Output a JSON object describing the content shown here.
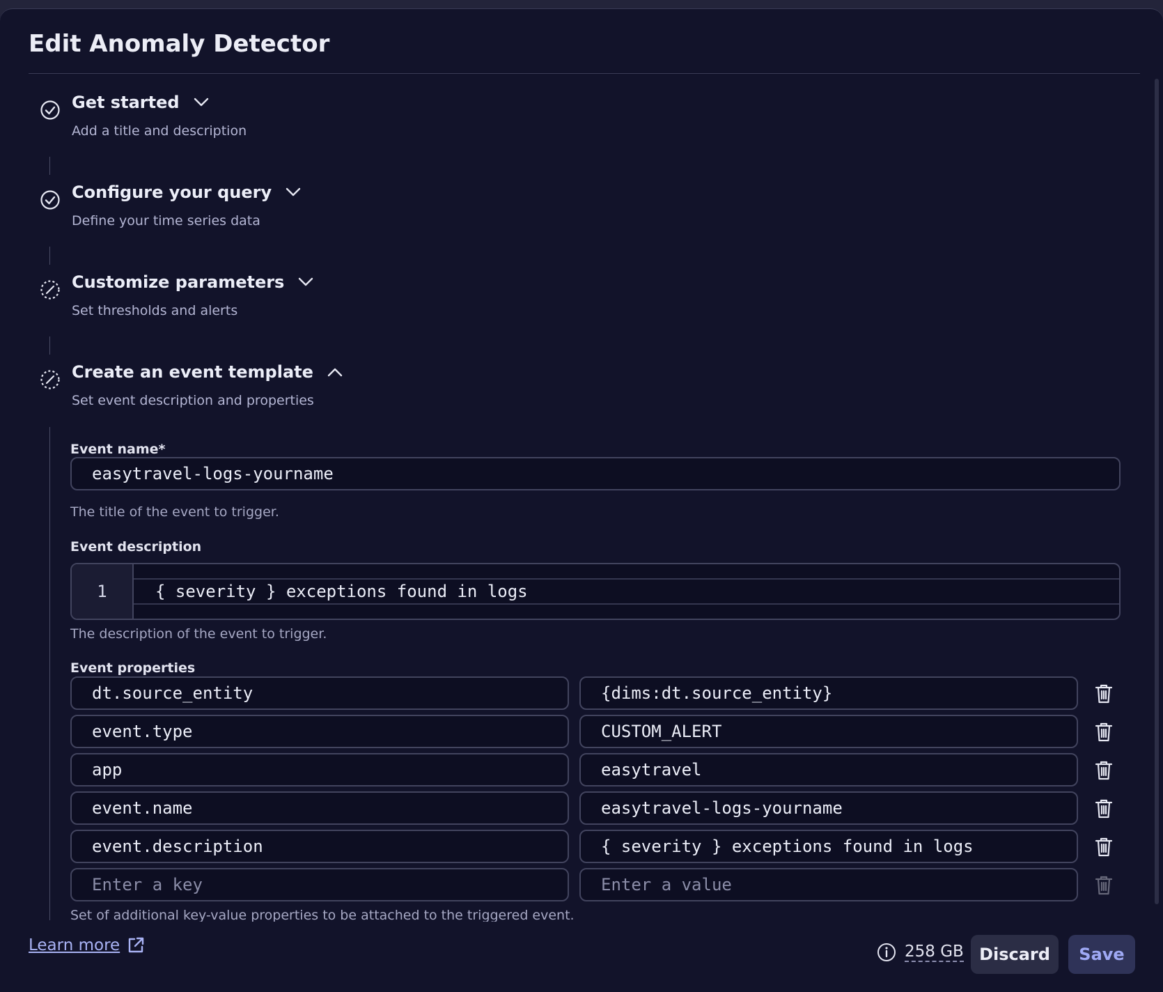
{
  "dialog": {
    "title": "Edit Anomaly Detector"
  },
  "steps": [
    {
      "title": "Get started",
      "subtitle": "Add a title and description",
      "status": "complete",
      "expanded": false
    },
    {
      "title": "Configure your query",
      "subtitle": "Define your time series data",
      "status": "complete",
      "expanded": false
    },
    {
      "title": "Customize parameters",
      "subtitle": "Set thresholds and alerts",
      "status": "pending",
      "expanded": false
    },
    {
      "title": "Create an event template",
      "subtitle": "Set event description and properties",
      "status": "pending",
      "expanded": true
    }
  ],
  "event_template": {
    "name_label": "Event name*",
    "name_value": "easytravel-logs-yourname",
    "name_hint": "The title of the event to trigger.",
    "description_label": "Event description",
    "description_line_number": "1",
    "description_value": "{ severity } exceptions found in logs",
    "description_hint": "The description of the event to trigger.",
    "properties_label": "Event properties",
    "properties": [
      {
        "key": "dt.source_entity",
        "value": "{dims:dt.source_entity}"
      },
      {
        "key": "event.type",
        "value": "CUSTOM_ALERT"
      },
      {
        "key": "app",
        "value": "easytravel"
      },
      {
        "key": "event.name",
        "value": "easytravel-logs-yourname"
      },
      {
        "key": "event.description",
        "value": "{ severity } exceptions found in logs"
      }
    ],
    "new_property": {
      "key_placeholder": "Enter a key",
      "value_placeholder": "Enter a value"
    },
    "properties_hint": "Set of additional key-value properties to be attached to the triggered event."
  },
  "footer": {
    "learn_more": "Learn more",
    "storage": "258 GB",
    "discard_label": "Discard",
    "save_label": "Save"
  },
  "colors": {
    "background": "#12132a",
    "accent": "#a9b3f5",
    "border": "#42445e"
  }
}
